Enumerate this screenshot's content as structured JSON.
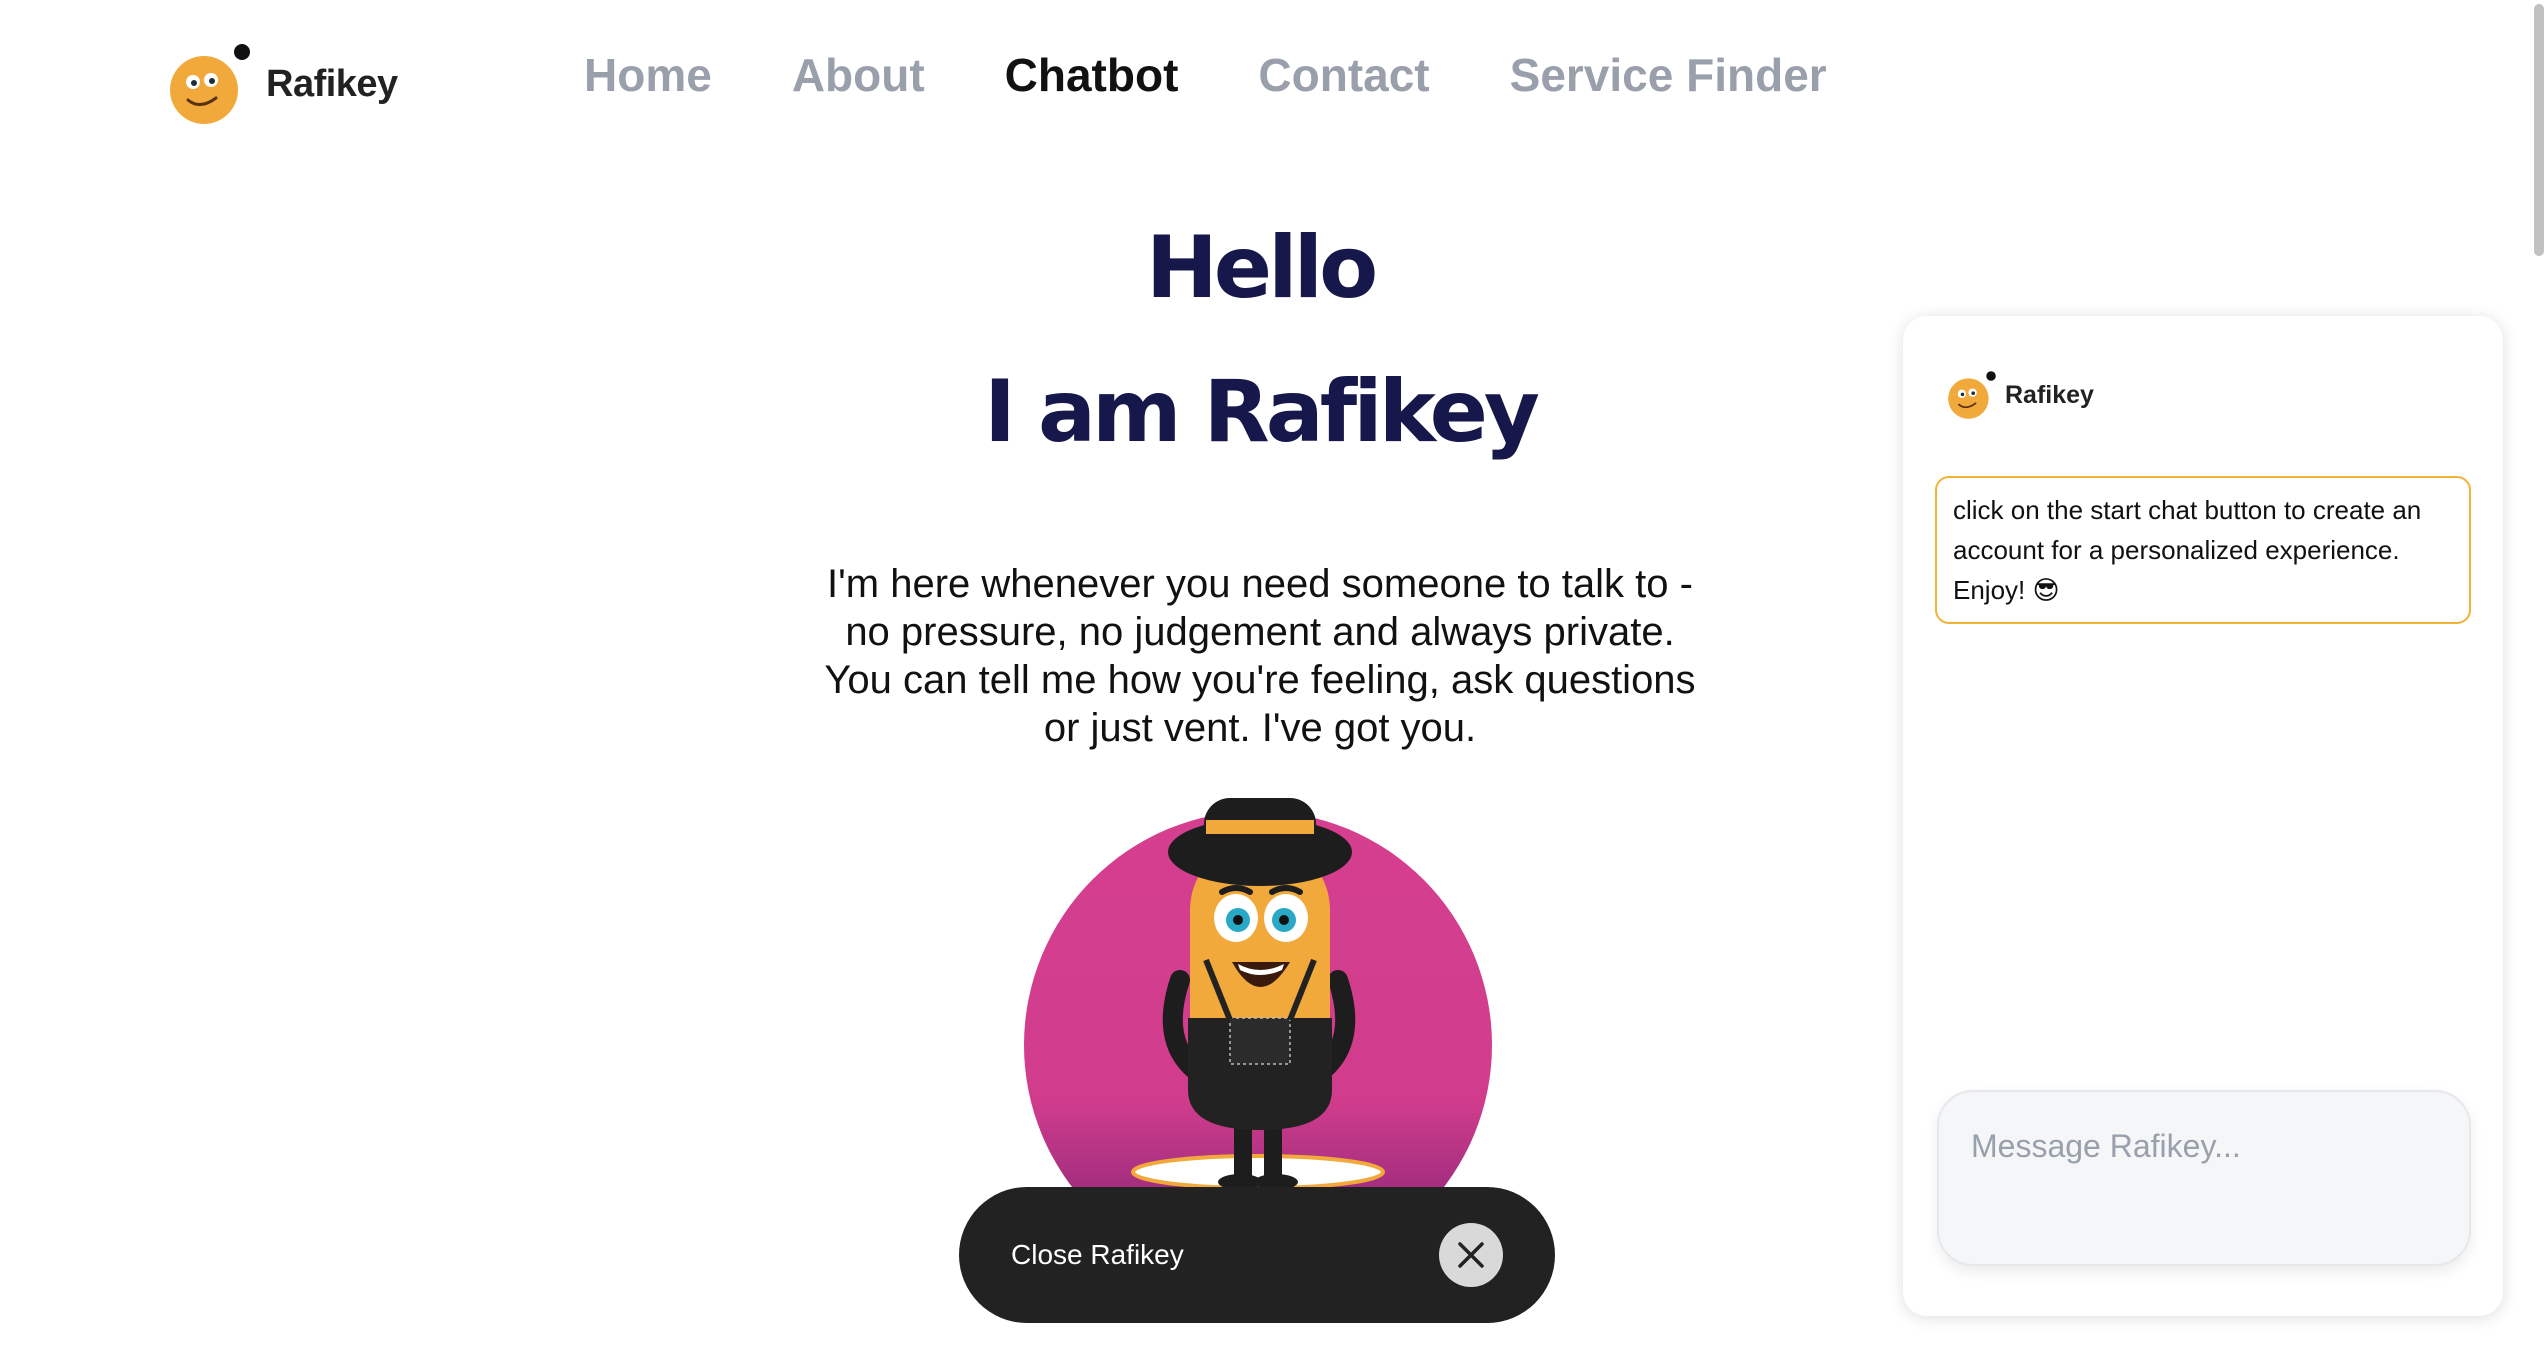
{
  "brand": {
    "name": "Rafikey",
    "logo_icon": "smiley-face-icon"
  },
  "nav": {
    "items": [
      {
        "label": "Home",
        "active": false
      },
      {
        "label": "About",
        "active": false
      },
      {
        "label": "Chatbot",
        "active": true
      },
      {
        "label": "Contact",
        "active": false
      },
      {
        "label": "Service Finder",
        "active": false
      }
    ]
  },
  "hero": {
    "line1": "Hello",
    "line2": "I am Rafikey",
    "intro": "I'm here whenever you need someone to talk to - no pressure, no judgement and always private. You can tell me how you're feeling, ask questions or just vent. I've got you."
  },
  "mascot": {
    "icon": "rafikey-mascot-illustration"
  },
  "close_pill": {
    "label": "Close Rafikey",
    "icon": "close-icon"
  },
  "chat": {
    "header_name": "Rafikey",
    "message": "click on the start chat button to create an account for a personalized experience. Enjoy! 😎",
    "input_placeholder": "Message Rafikey..."
  },
  "colors": {
    "accent": "#f2a93b",
    "title": "#16174a",
    "nav_inactive": "#9aa0ab",
    "circle": "#d13f8e",
    "pill": "#222222"
  }
}
